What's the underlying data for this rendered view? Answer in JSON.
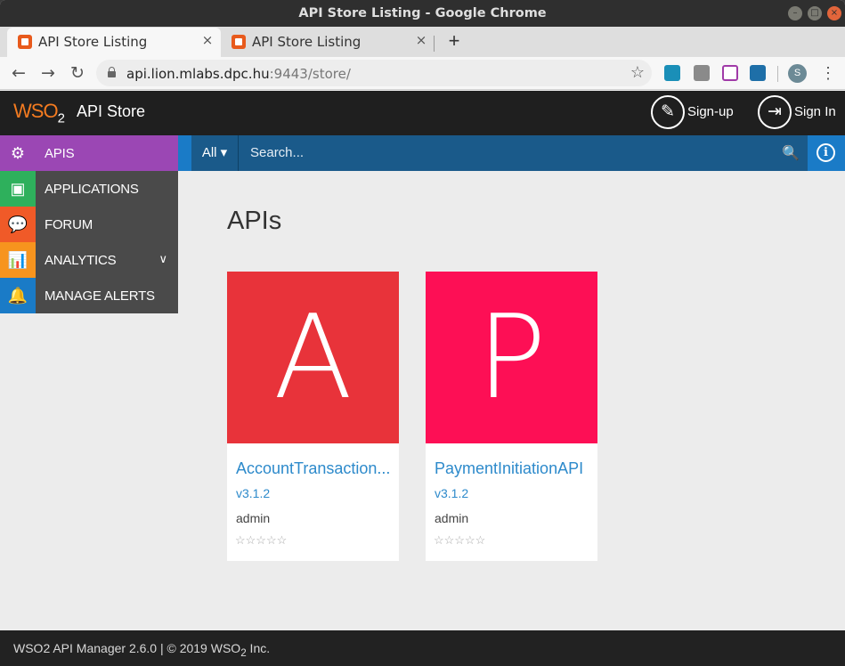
{
  "window": {
    "title": "API Store Listing - Google Chrome",
    "controls": {
      "minimize": "–",
      "maximize": "□",
      "close": "×"
    }
  },
  "tabs": [
    {
      "label": "API Store Listing",
      "close": "×"
    },
    {
      "label": "API Store Listing",
      "close": "×"
    }
  ],
  "new_tab": "+",
  "toolbar": {
    "back": "←",
    "forward": "→",
    "reload": "↻",
    "url_host": "api.lion.mlabs.dpc.hu",
    "url_rest": ":9443/store/",
    "star": "☆",
    "profile_initial": "S",
    "menu": "⋮"
  },
  "header": {
    "logo_text": "WSO",
    "logo_sub": "2",
    "brand": "API Store",
    "signup": "Sign-up",
    "signin": "Sign In"
  },
  "sidebar": {
    "items": [
      {
        "label": "APIS",
        "color": "#9b47b4",
        "icon": "gear-api-icon"
      },
      {
        "label": "APPLICATIONS",
        "color": "#2eb05c",
        "icon": "application-icon"
      },
      {
        "label": "FORUM",
        "color": "#f05a28",
        "icon": "forum-icon"
      },
      {
        "label": "ANALYTICS",
        "color": "#f7941e",
        "icon": "chart-icon"
      },
      {
        "label": "MANAGE ALERTS",
        "color": "#1a7bc7",
        "icon": "bell-icon"
      }
    ]
  },
  "search": {
    "filter": "All",
    "placeholder": "Search..."
  },
  "main": {
    "heading": "APIs",
    "apis": [
      {
        "letter": "A",
        "name": "AccountTransaction...",
        "version": "v3.1.2",
        "provider": "admin",
        "rating": "☆☆☆☆☆",
        "color": "#e8333a"
      },
      {
        "letter": "P",
        "name": "PaymentInitiationAPI",
        "version": "v3.1.2",
        "provider": "admin",
        "rating": "☆☆☆☆☆",
        "color": "#fd0f55"
      }
    ]
  },
  "footer": {
    "text": "WSO2 API Manager 2.6.0 | © 2019 WSO",
    "sub": "2",
    "suffix": " Inc."
  }
}
